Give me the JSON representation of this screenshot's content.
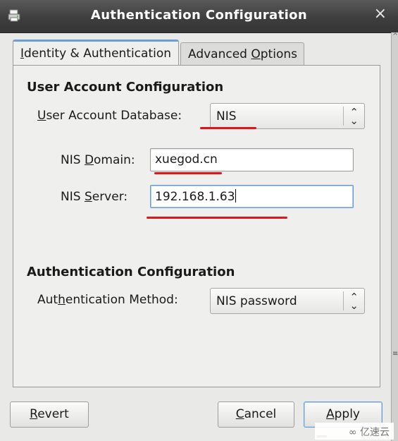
{
  "window": {
    "title": "Authentication Configuration",
    "app_icon": "printer-config-icon",
    "close_icon": "close-icon"
  },
  "tabs": [
    {
      "pre": "",
      "mn": "I",
      "post": "dentity & Authentication",
      "active": true
    },
    {
      "pre": "Advanced ",
      "mn": "O",
      "post": "ptions",
      "active": false
    }
  ],
  "user_account": {
    "heading": "User Account Configuration",
    "db_label": {
      "pre": "",
      "mn": "U",
      "post": "ser Account Database:"
    },
    "db_value": "NIS",
    "nis_domain_label": {
      "pre": "NIS ",
      "mn": "D",
      "post": "omain:"
    },
    "nis_domain_value": "xuegod.cn",
    "nis_server_label": {
      "pre": "NIS ",
      "mn": "S",
      "post": "erver:"
    },
    "nis_server_value": "192.168.1.63"
  },
  "authentication": {
    "heading": "Authentication Configuration",
    "method_label": {
      "pre": "Aut",
      "mn": "h",
      "post": "entication Method:"
    },
    "method_value": "NIS password"
  },
  "buttons": {
    "revert": {
      "pre": "",
      "mn": "R",
      "post": "evert"
    },
    "cancel": {
      "pre": "",
      "mn": "C",
      "post": "ancel"
    },
    "apply": {
      "pre": "",
      "mn": "A",
      "post": "pply"
    }
  },
  "watermark": "亿速云",
  "colors": {
    "annotation_red": "#e2141a",
    "focus_blue": "#6a9bd2",
    "titlebar": "#3e3e3e"
  }
}
